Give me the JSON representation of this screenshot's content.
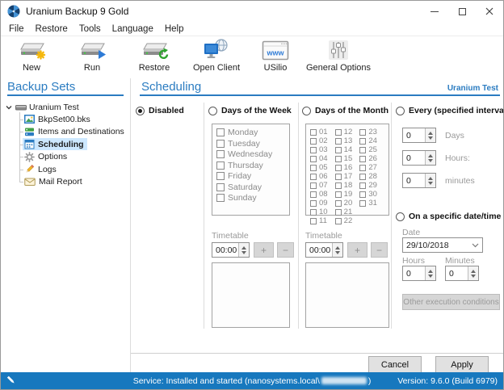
{
  "window": {
    "title": "Uranium Backup 9 Gold"
  },
  "menu": {
    "items": [
      "File",
      "Restore",
      "Tools",
      "Language",
      "Help"
    ]
  },
  "toolbar": {
    "buttons": [
      {
        "label": "New"
      },
      {
        "label": "Run"
      },
      {
        "label": "Restore"
      },
      {
        "label": "Open Client"
      },
      {
        "label": "USilio",
        "www": "www"
      },
      {
        "label": "General Options"
      }
    ]
  },
  "sidebar": {
    "header": "Backup Sets",
    "tree": {
      "root": "Uranium Test",
      "children": [
        {
          "label": "BkpSet00.bks"
        },
        {
          "label": "Items and Destinations"
        },
        {
          "label": "Scheduling",
          "selected": true
        },
        {
          "label": "Options"
        },
        {
          "label": "Logs"
        },
        {
          "label": "Mail Report"
        }
      ]
    }
  },
  "main": {
    "header": "Scheduling",
    "context_label": "Uranium Test",
    "selected_option": "Disabled",
    "options": {
      "disabled": "Disabled",
      "week": "Days of the Week",
      "month": "Days of the Month",
      "interval": "Every (specified interval)",
      "specific": "On a specific date/time"
    },
    "week": {
      "days": [
        "Monday",
        "Tuesday",
        "Wednesday",
        "Thursday",
        "Friday",
        "Saturday",
        "Sunday"
      ],
      "timetable_label": "Timetable",
      "time_value": "00:00",
      "add": "+",
      "remove": "−"
    },
    "month": {
      "days": [
        "01",
        "02",
        "03",
        "04",
        "05",
        "06",
        "07",
        "08",
        "09",
        "10",
        "11",
        "12",
        "13",
        "14",
        "15",
        "16",
        "17",
        "18",
        "19",
        "20",
        "21",
        "22",
        "23",
        "24",
        "25",
        "26",
        "27",
        "28",
        "29",
        "30",
        "31"
      ],
      "timetable_label": "Timetable",
      "time_value": "00:00",
      "add": "+",
      "remove": "−"
    },
    "interval": {
      "rows": [
        {
          "value": "0",
          "unit": "Days"
        },
        {
          "value": "0",
          "unit": "Hours:"
        },
        {
          "value": "0",
          "unit": "minutes"
        }
      ]
    },
    "specific": {
      "date_label": "Date",
      "date_value": "29/10/2018",
      "hours_label": "Hours",
      "minutes_label": "Minutes",
      "hours_value": "0",
      "minutes_value": "0",
      "other_button": "Other execution conditions"
    },
    "footer": {
      "cancel": "Cancel",
      "apply": "Apply"
    }
  },
  "status_bar": {
    "service_text_prefix": "Service: Installed and started (nanosystems.local\\",
    "service_text_suffix": ")",
    "version_text": "Version: 9.6.0 (Build 6979)"
  },
  "icons": {
    "app-icon": "blue-radiation-sphere",
    "new-badge": "yellow-star",
    "run-badge": "blue-play-triangle",
    "restore-badge": "green-refresh-arrow",
    "open-client-icon": "monitor-with-globe",
    "usilio-icon": "browser-window-www",
    "general-options-icon": "mixer-sliders",
    "tree-root-icon": "drive",
    "bkpset-icon": "picture",
    "items-icon": "stacked-bars",
    "scheduling-icon": "calendar",
    "options-icon": "gear",
    "logs-icon": "pencil",
    "mail-icon": "envelope",
    "status-icon": "white-pencil"
  },
  "colors": {
    "header_blue": "#2b7cc1",
    "status_bar_blue": "#1778be",
    "selection_blue": "#cde8ff",
    "disabled_text": "#8a8a8a"
  }
}
